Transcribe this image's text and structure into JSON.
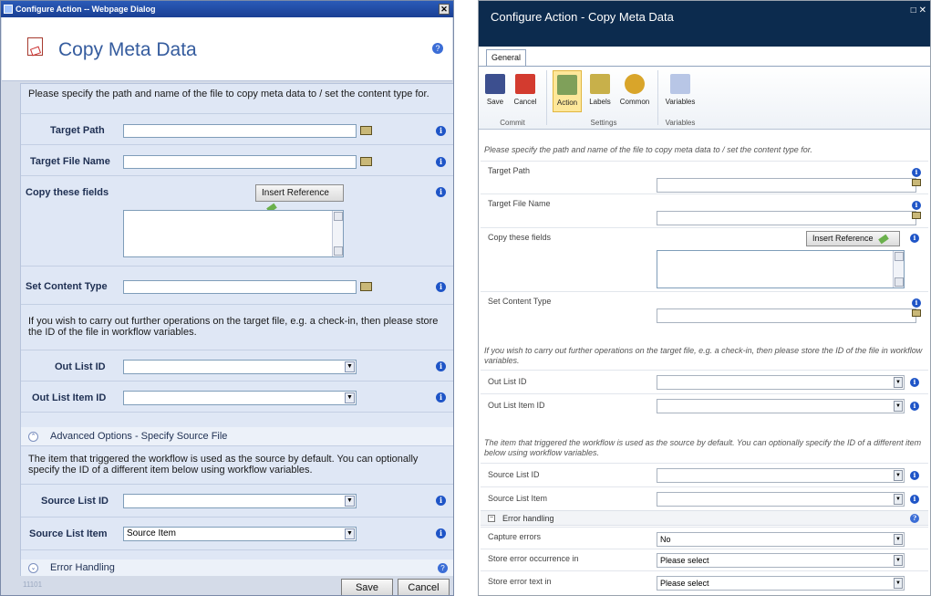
{
  "left": {
    "window_title": "Configure Action -- Webpage Dialog",
    "close_glyph": "✕",
    "header_title": "Copy Meta Data",
    "description": "Please specify the path and name of the file to copy meta data to / set the content type for.",
    "fields": {
      "target_path": "Target Path",
      "target_file_name": "Target File Name",
      "copy_fields": "Copy these fields",
      "set_content_type": "Set Content Type",
      "out_list_id": "Out List ID",
      "out_list_item_id": "Out List Item ID",
      "source_list_id": "Source List ID",
      "source_list_item": "Source List Item"
    },
    "insert_reference": "Insert Reference",
    "further_ops_text": "If you wish to carry out further operations on the target file, e.g. a check-in, then please store the ID of the file in workflow variables.",
    "advanced_section": "Advanced Options - Specify Source File",
    "source_text": "The item that triggered the workflow is used as the source by default. You can optionally specify the ID of a different item below using workflow variables.",
    "source_list_item_value": "Source Item",
    "error_section": "Error Handling",
    "version": "11101",
    "save": "Save",
    "cancel": "Cancel"
  },
  "right": {
    "window_title": "Configure Action - Copy Meta Data",
    "window_controls": "□ ✕",
    "tab_general": "General",
    "ribbon": {
      "save": "Save",
      "cancel": "Cancel",
      "action": "Action",
      "labels": "Labels",
      "common": "Common",
      "variables": "Variables",
      "group_commit": "Commit",
      "group_settings": "Settings",
      "group_variables": "Variables"
    },
    "description": "Please specify the path and name of the file to copy meta data to / set the content type for.",
    "fields": {
      "target_path": "Target Path",
      "target_file_name": "Target File Name",
      "copy_fields": "Copy these fields",
      "set_content_type": "Set Content Type",
      "out_list_id": "Out List ID",
      "out_list_item_id": "Out List Item ID",
      "source_list_id": "Source List ID",
      "source_list_item": "Source List Item",
      "capture_errors": "Capture errors",
      "store_error_occurrence": "Store error occurrence in",
      "store_error_text": "Store error text in"
    },
    "insert_reference": "Insert Reference",
    "further_ops_text": "If you wish to carry out further operations on the target file, e.g. a check-in, then please store the ID of the file in workflow variables.",
    "source_text": "The item that triggered the workflow is used as the source by default. You can optionally specify the ID of a different item below using workflow variables.",
    "error_section": "Error handling",
    "capture_errors_value": "No",
    "store_error_occurrence_value": "Please select",
    "store_error_text_value": "Please select",
    "collapse_glyph": "−"
  },
  "glyphs": {
    "info": "i",
    "help": "?",
    "arrow_down": "▼",
    "arrow_up": "▲",
    "chevron_up": "⌃",
    "chevron_down": "⌄"
  },
  "colors": {
    "left_titlebar": "#1a3f94",
    "left_title_text": "#355c9e",
    "right_titlebar": "#0c2b4e",
    "info_blue": "#1f55c7",
    "active_ribbon": "#fde79a"
  }
}
